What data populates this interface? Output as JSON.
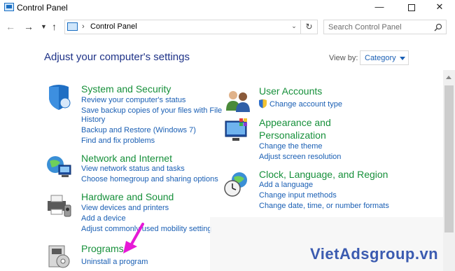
{
  "window": {
    "title": "Control Panel"
  },
  "nav": {
    "address": "Control Panel",
    "search_placeholder": "Search Control Panel"
  },
  "header": {
    "title": "Adjust your computer's settings",
    "view_by_label": "View by:",
    "view_by_value": "Category"
  },
  "categories": {
    "system": {
      "title": "System and Security",
      "links": [
        "Review your computer's status",
        "Save backup copies of your files with File",
        "History",
        "Backup and Restore (Windows 7)",
        "Find and fix problems"
      ]
    },
    "network": {
      "title": "Network and Internet",
      "links": [
        "View network status and tasks",
        "Choose homegroup and sharing options"
      ]
    },
    "hardware": {
      "title": "Hardware and Sound",
      "links": [
        "View devices and printers",
        "Add a device",
        "Adjust commonly used mobility settings"
      ]
    },
    "programs": {
      "title": "Programs",
      "links": [
        "Uninstall a program"
      ]
    },
    "users": {
      "title": "User Accounts",
      "links": [
        "Change account type"
      ]
    },
    "appearance": {
      "title": "Appearance and",
      "title2": "Personalization",
      "links": [
        "Change the theme",
        "Adjust screen resolution"
      ]
    },
    "clock": {
      "title": "Clock, Language, and Region",
      "links": [
        "Add a language",
        "Change input methods",
        "Change date, time, or number formats"
      ]
    }
  },
  "watermark": "VietAdsgroup.vn",
  "colors": {
    "link": "#1a5fb4",
    "category_title": "#17903b",
    "page_title": "#1e3287",
    "annotation_arrow": "#e619d6"
  }
}
